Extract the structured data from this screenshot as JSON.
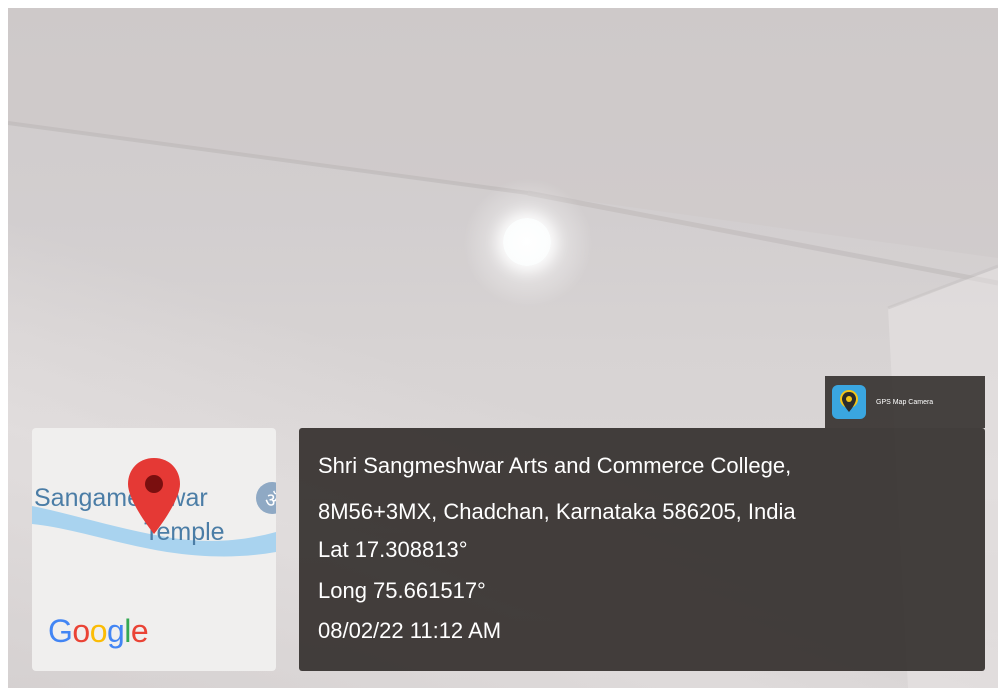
{
  "app_badge": {
    "name": "GPS Map Camera",
    "icon": "gps-map-camera-logo-icon",
    "color": "#3aa6e0"
  },
  "map": {
    "place_label_line1": "Sangameshwar",
    "place_label_line2": "Temple",
    "marker_icon": "map-pin-icon",
    "marker_color": "#e53935",
    "logo_text": "Google"
  },
  "location_info": {
    "name": "Shri Sangmeshwar Arts and Commerce College,",
    "address": "8M56+3MX, Chadchan, Karnataka 586205, India",
    "latitude": "Lat 17.308813°",
    "longitude": "Long 75.661517°",
    "datetime": "08/02/22 11:12 AM"
  }
}
